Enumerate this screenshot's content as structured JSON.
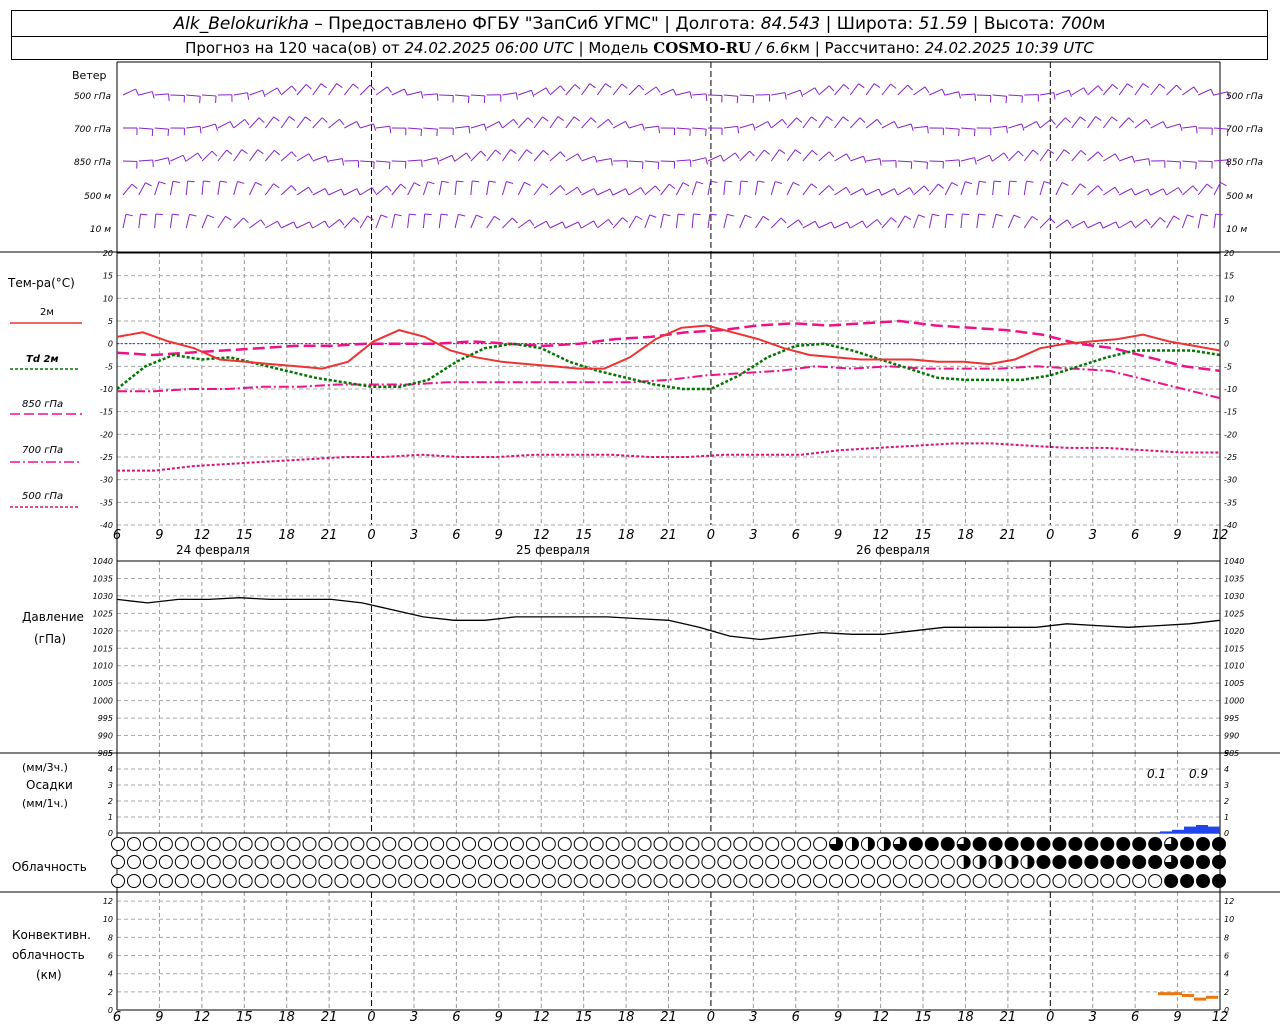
{
  "header": {
    "station": "Alk_Belokurikha",
    "dash": " – ",
    "provider": "Предоставлено ФГБУ \"ЗапСиб УГМС\"",
    "sep": " | ",
    "lon_label": "Долгота: ",
    "lon_value": "84.543",
    "lat_label": "Широта: ",
    "lat_value": "51.59",
    "alt_label": "Высота: ",
    "alt_value": "700",
    "alt_unit": "м",
    "forecast_label": "Прогноз на 120 часа(ов) от ",
    "forecast_start": "24.02.2025 06:00 UTC",
    "model_label": " | Модель ",
    "model_name": "COSMO-RU",
    "model_res": " / 6.6",
    "model_res_unit": "км",
    "computed_label": " | Рассчитано: ",
    "computed_time": "24.02.2025 10:39 UTC"
  },
  "labels": {
    "wind": "Ветер",
    "wind_levels": [
      "500 гПа",
      "700 гПа",
      "850 гПа",
      "500 м",
      "10 м"
    ],
    "temp": "Тем-ра(°C)",
    "temp_legend": [
      "2м",
      "Td  2м",
      "850 гПа",
      "700 гПа",
      "500 гПа"
    ],
    "pressure": "Давление",
    "pressure_unit": "(гПа)",
    "precip_unit1": "(мм/3ч.)",
    "precip": "Осадки",
    "precip_unit2": "(мм/1ч.)",
    "cloud": "Облачность",
    "conv1": "Конвективн.",
    "conv2": "облачность",
    "conv3": "(км)",
    "precip_annot": [
      "0.1",
      "0.9"
    ],
    "days": [
      "24 февраля",
      "25 февраля",
      "26 февраля"
    ]
  },
  "colors": {
    "t2m": "#ee3333",
    "td2m": "#007700",
    "t850": "#ee1188",
    "t700": "#ee1188",
    "t500": "#dd1177",
    "wind": "#8822cc",
    "precip": "#2244ee",
    "conv": "#ee7711",
    "zero_line": "#3333cc"
  },
  "chart_data": [
    {
      "type": "line",
      "title": "Тем-ра(°C)",
      "ylim": [
        -40,
        20
      ],
      "x_ticks": [
        "6",
        "9",
        "12",
        "15",
        "18",
        "21",
        "0",
        "3",
        "6",
        "9",
        "12",
        "15",
        "18",
        "21",
        "0",
        "3",
        "6",
        "9",
        "12",
        "15",
        "18",
        "21",
        "0",
        "3",
        "6",
        "9",
        "12"
      ],
      "x": [
        0,
        3,
        6,
        9,
        12,
        15,
        18,
        21,
        24,
        27,
        30,
        33,
        36,
        39,
        42,
        45,
        48,
        51,
        54,
        57,
        60,
        63,
        66,
        69,
        72,
        75,
        78
      ],
      "series": [
        {
          "name": "2м",
          "values": [
            1.5,
            2.5,
            0.5,
            -1,
            -3.5,
            -4,
            -4.5,
            -5,
            -5.5,
            -4,
            0.5,
            3,
            1.5,
            -1.5,
            -3,
            -4,
            -4.5,
            -5,
            -5.5,
            -5.5,
            -3,
            1,
            3.5,
            4,
            2.5,
            1,
            -1,
            -2.5,
            -3,
            -3.5,
            -3.5,
            -3.5,
            -4,
            -4,
            -4.5,
            -3.5,
            -1,
            0,
            0.5,
            1,
            2,
            0.5,
            -0.5,
            -1.5
          ]
        },
        {
          "name": "Td  2м",
          "values": [
            -10,
            -5,
            -2.5,
            -3.5,
            -3,
            -4.5,
            -6,
            -7.5,
            -8.5,
            -9.5,
            -9.5,
            -8,
            -4,
            -1,
            0,
            -1,
            -4,
            -6,
            -7.5,
            -9,
            -10,
            -10,
            -7,
            -3,
            -0.5,
            0,
            -1.5,
            -3.5,
            -5.5,
            -7.5,
            -8,
            -8,
            -8,
            -7,
            -5,
            -3,
            -1.5,
            -1.5,
            -1.5,
            -2.5
          ]
        },
        {
          "name": "850 гПа",
          "values": [
            -2,
            -2.5,
            -2,
            -1.5,
            -1,
            -0.5,
            -0.5,
            0,
            0,
            0,
            0.5,
            0,
            -0.5,
            0,
            1,
            1.5,
            2.5,
            3,
            4,
            4.5,
            4,
            4.5,
            5,
            4,
            3.5,
            3,
            2,
            0,
            -1,
            -3,
            -5,
            -6
          ]
        },
        {
          "name": "700 гПа",
          "values": [
            -10.5,
            -10.5,
            -10,
            -10,
            -9.5,
            -9.5,
            -9,
            -9,
            -9,
            -8.5,
            -8.5,
            -8.5,
            -8.5,
            -8.5,
            -8.5,
            -8,
            -7,
            -6.5,
            -6,
            -5,
            -5.5,
            -5,
            -5.5,
            -5.5,
            -5.5,
            -5,
            -5.5,
            -6,
            -8,
            -10,
            -12
          ]
        },
        {
          "name": "500 гПа",
          "values": [
            -28,
            -28,
            -27,
            -26.5,
            -26,
            -25.5,
            -25,
            -25,
            -24.5,
            -25,
            -25,
            -24.5,
            -24.5,
            -24.5,
            -25,
            -25,
            -24.5,
            -24.5,
            -24.5,
            -23.5,
            -23,
            -22.5,
            -22,
            -22,
            -22.5,
            -23,
            -23,
            -23.5,
            -24,
            -24
          ]
        }
      ]
    },
    {
      "type": "line",
      "title": "Давление",
      "ylabel": "(гПа)",
      "ylim": [
        985,
        1040
      ],
      "series": [
        {
          "name": "Давление",
          "values": [
            1029,
            1028,
            1029,
            1029,
            1029.5,
            1029,
            1029,
            1029,
            1028,
            1026,
            1024,
            1023,
            1023,
            1024,
            1024,
            1024,
            1024,
            1023.5,
            1023,
            1021,
            1018.5,
            1017.5,
            1018.5,
            1019.5,
            1019,
            1019,
            1020,
            1021,
            1021,
            1021,
            1021,
            1022,
            1021.5,
            1021,
            1021.5,
            1022,
            1023
          ]
        }
      ]
    },
    {
      "type": "bar",
      "title": "Осадки",
      "ylim": [
        0,
        5
      ],
      "annotations": [
        "0.1",
        "0.9"
      ],
      "values_last_hours": [
        0.1,
        0.2,
        0.4,
        0.5,
        0.4
      ]
    },
    {
      "type": "table",
      "title": "Облачность",
      "rows": 3,
      "columns": 57,
      "cover_rows": [
        [
          0,
          0,
          0,
          0,
          0,
          0,
          0,
          0,
          0,
          0,
          0,
          0,
          0,
          0,
          0,
          0,
          0,
          0,
          0,
          0,
          0,
          0,
          0,
          0,
          0,
          0,
          0,
          0,
          0,
          0,
          0,
          0,
          0,
          0,
          0,
          0,
          0,
          0,
          0,
          0,
          0,
          0,
          0,
          0,
          0,
          0.75,
          0.5,
          0.5,
          0.5,
          0.75,
          1,
          1,
          1,
          0.75,
          1,
          1,
          1,
          1,
          1,
          1,
          1,
          1,
          1,
          1,
          1,
          1,
          0.75,
          1,
          1,
          1
        ],
        [
          0,
          0,
          0,
          0,
          0,
          0,
          0,
          0,
          0,
          0,
          0,
          0,
          0,
          0,
          0,
          0,
          0,
          0,
          0,
          0,
          0,
          0,
          0,
          0,
          0,
          0,
          0,
          0,
          0,
          0,
          0,
          0,
          0,
          0,
          0,
          0,
          0,
          0,
          0,
          0,
          0,
          0,
          0,
          0,
          0,
          0,
          0,
          0,
          0,
          0,
          0,
          0,
          0,
          0.5,
          0.5,
          0.5,
          0.5,
          0.5,
          1,
          1,
          1,
          1,
          1,
          1,
          1,
          1,
          0.75,
          1,
          1,
          1
        ],
        [
          0,
          0,
          0,
          0,
          0,
          0,
          0,
          0,
          0,
          0,
          0,
          0,
          0,
          0,
          0,
          0,
          0,
          0,
          0,
          0,
          0,
          0,
          0,
          0,
          0,
          0,
          0,
          0,
          0,
          0,
          0,
          0,
          0,
          0,
          0,
          0,
          0,
          0,
          0,
          0,
          0,
          0,
          0,
          0,
          0,
          0,
          0,
          0,
          0,
          0,
          0,
          0,
          0,
          0,
          0,
          0,
          0,
          0,
          0,
          0,
          0,
          0,
          0,
          0,
          0,
          0,
          1,
          1,
          1,
          1
        ]
      ]
    },
    {
      "type": "line",
      "title": "Конвективн. облачность",
      "ylabel": "(км)",
      "ylim": [
        0,
        13
      ],
      "series": [
        {
          "name": "Конвективн. облачность",
          "values": [
            1.8,
            1.8,
            1.6,
            1.2,
            1.4
          ]
        }
      ]
    }
  ]
}
